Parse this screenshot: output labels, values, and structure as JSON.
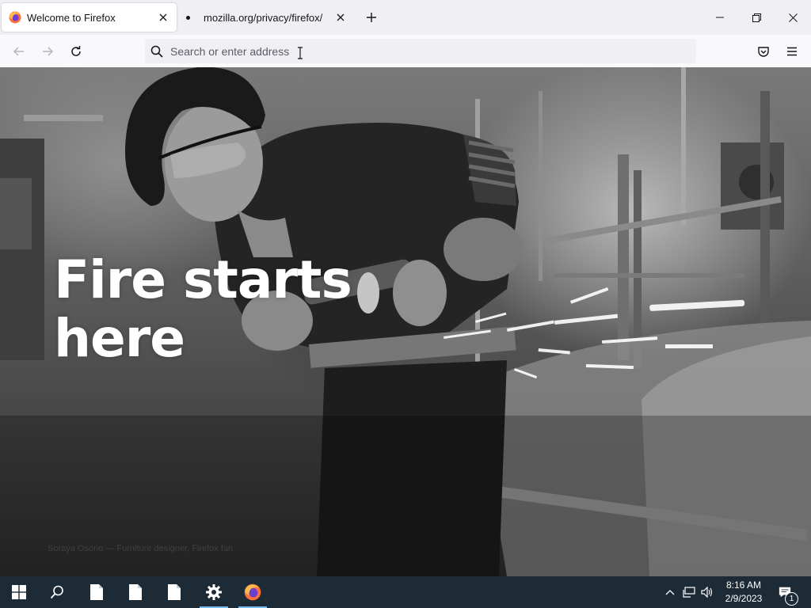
{
  "browser": {
    "tabs": [
      {
        "title": "Welcome to Firefox",
        "active": true
      },
      {
        "title": "mozilla.org/privacy/firefox/",
        "active": false
      }
    ],
    "address_bar": {
      "placeholder": "Search or enter address",
      "value": ""
    }
  },
  "page": {
    "headline_line1": "Fire starts",
    "headline_line2": "here",
    "photo_caption": "Soraya Osorio — Furniture designer, Firefox fan"
  },
  "taskbar": {
    "clock_time": "8:16 AM",
    "clock_date": "2/9/2023",
    "notification_count": "1"
  },
  "colors": {
    "accent": "#76b9ed",
    "taskbar_bg": "#1c2b36",
    "tabstrip_bg": "#f0f0f4"
  }
}
